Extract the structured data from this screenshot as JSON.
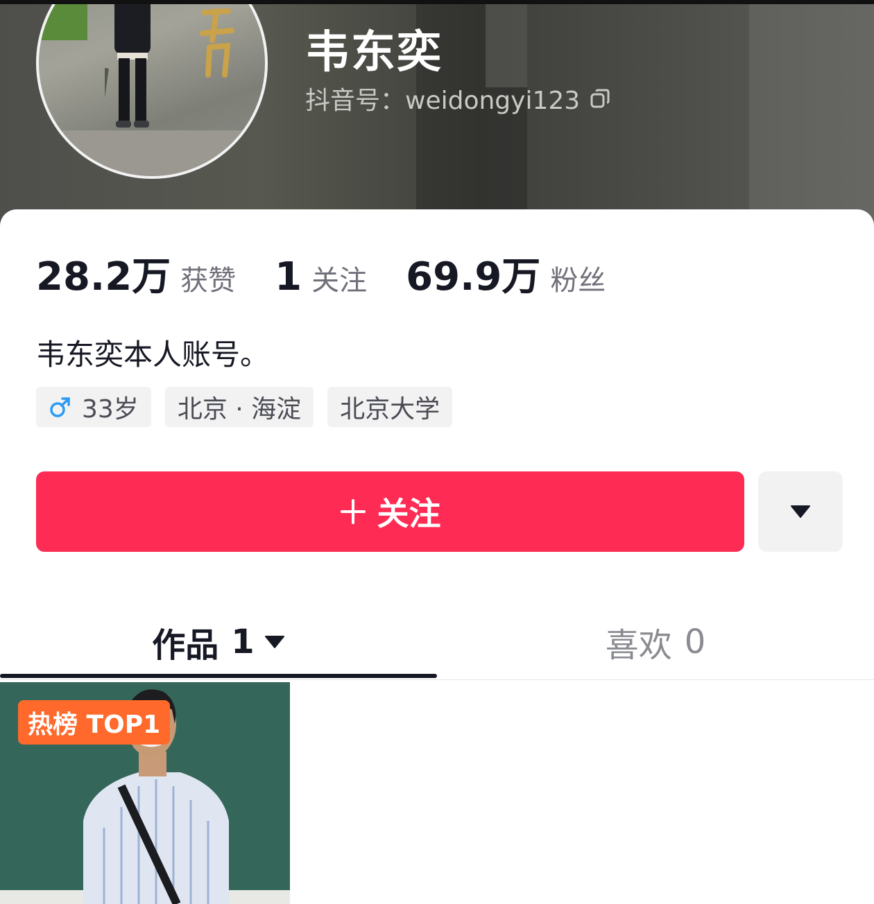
{
  "profile": {
    "name": "韦东奕",
    "douyin_id": "抖音号：weidongyi123"
  },
  "stats": [
    {
      "value": "28.2万",
      "label": "获赞"
    },
    {
      "value": "1",
      "label": "关注"
    },
    {
      "value": "69.9万",
      "label": "粉丝"
    }
  ],
  "bio": "韦东奕本人账号。",
  "tags": {
    "age": "33岁",
    "gender_icon": "male-icon",
    "location": "北京 · 海淀",
    "school": "北京大学"
  },
  "actions": {
    "follow_label": "关注",
    "follow_color": "#fe2c55",
    "more_icon": "caret-down-icon"
  },
  "tabs": {
    "works_label": "作品",
    "works_count": "1",
    "likes_label": "喜欢",
    "likes_count": "0"
  },
  "videos": [
    {
      "badge": "热榜 TOP1",
      "badge_color": "#ff6a2c"
    }
  ]
}
